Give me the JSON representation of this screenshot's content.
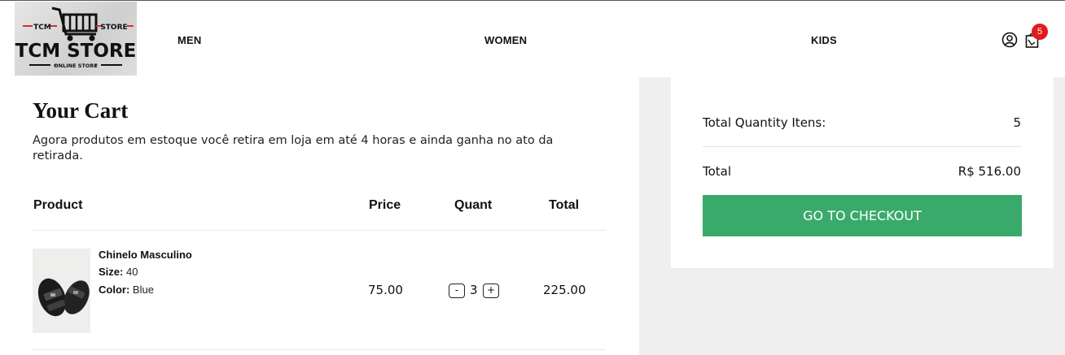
{
  "brand": {
    "logo_top_left": "TCM",
    "logo_top_right": "STORE",
    "logo_main": "TCM STORE",
    "logo_sub": "ONLINE STORE"
  },
  "nav": {
    "items": [
      {
        "label": "MEN"
      },
      {
        "label": "WOMEN"
      },
      {
        "label": "KIDS"
      }
    ],
    "cart_count": "5",
    "user_icon": "user-icon",
    "cart_icon": "shopping-bag-icon"
  },
  "cart": {
    "title": "Your Cart",
    "description": "Agora produtos em estoque você retira em loja em até 4 horas e ainda ganha no ato da retirada.",
    "columns": {
      "product": "Product",
      "price": "Price",
      "quant": "Quant",
      "total": "Total"
    },
    "items": [
      {
        "name": "Chinelo Masculino",
        "size_label": "Size:",
        "size": "40",
        "color_label": "Color:",
        "color": "Blue",
        "price": "75.00",
        "quantity": "3",
        "total": "225.00",
        "decrement": "-",
        "increment": "+"
      }
    ]
  },
  "summary": {
    "quantity_label": "Total Quantity Itens:",
    "quantity_value": "5",
    "total_label": "Total",
    "total_value": "R$ 516.00",
    "checkout_label": "GO TO CHECKOUT"
  },
  "colors": {
    "checkout_button": "#3aaa6a",
    "badge": "#e01b1b",
    "summary_background": "#efefef"
  }
}
